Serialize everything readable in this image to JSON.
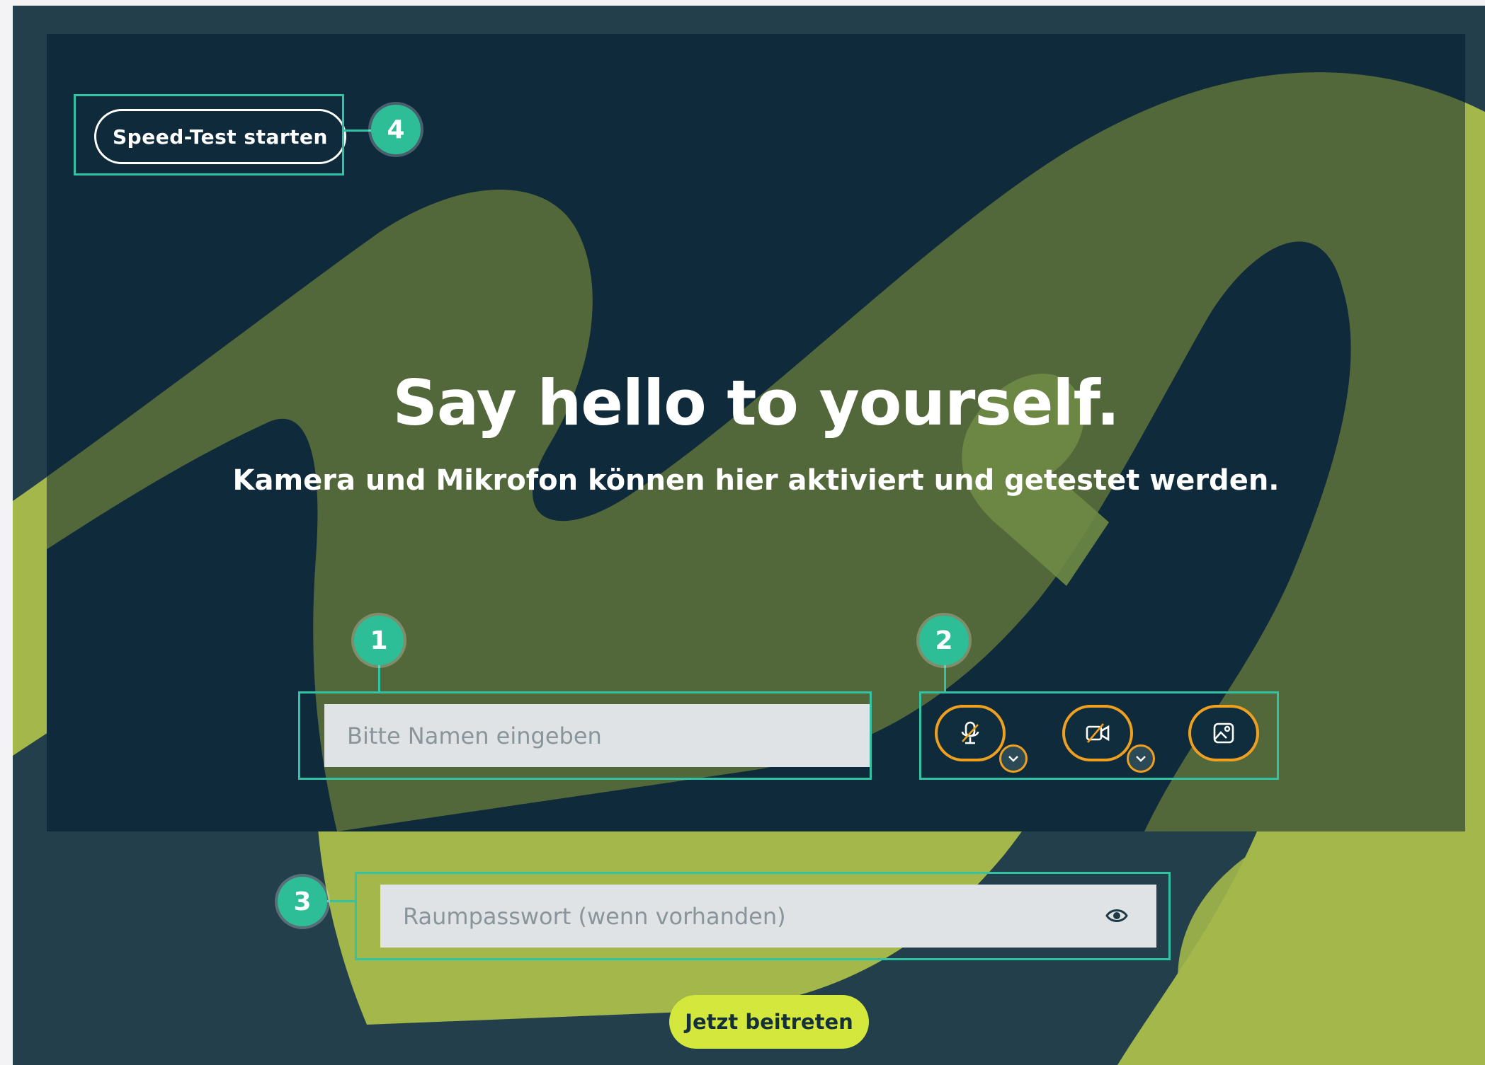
{
  "speed_test": {
    "label": "Speed-Test starten"
  },
  "hero": {
    "title": "Say hello to yourself.",
    "subtitle": "Kamera und Mikrofon können hier aktiviert und getestet werden."
  },
  "name_input": {
    "placeholder": "Bitte Namen eingeben",
    "value": ""
  },
  "password_input": {
    "placeholder": "Raumpasswort (wenn vorhanden)",
    "value": ""
  },
  "media_controls": [
    {
      "icon": "microphone-off-icon",
      "has_menu": true
    },
    {
      "icon": "camera-off-icon",
      "has_menu": true
    },
    {
      "icon": "image-background-icon",
      "has_menu": false
    }
  ],
  "join_button": {
    "label": "Jetzt beitreten"
  },
  "annotations": [
    "1",
    "2",
    "3",
    "4"
  ],
  "colors": {
    "background": "#223f4b",
    "panel": "#0e2a3b",
    "art_green": "#a3b74a",
    "highlight": "#32c3a4",
    "badge": "#2dbd97",
    "media_ring": "#f0a020",
    "join_button": "#d4e73c",
    "input_bg": "#dfe3e6"
  }
}
